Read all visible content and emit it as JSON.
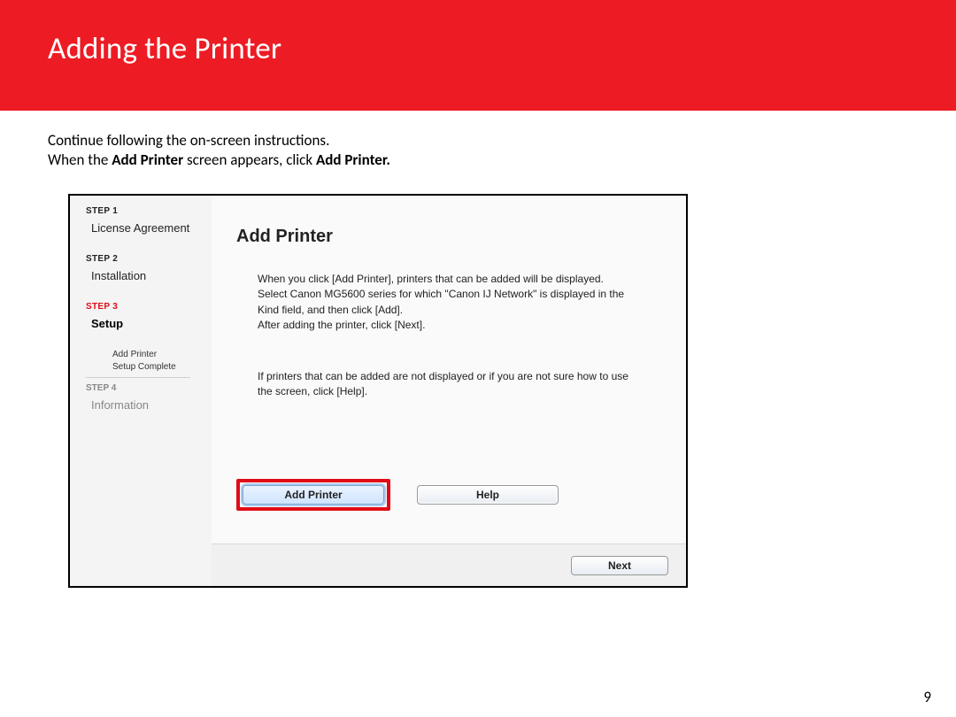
{
  "banner": {
    "title": "Adding  the Printer"
  },
  "body": {
    "line1": "Continue following the on-screen instructions.",
    "line2_pre": "When the ",
    "line2_b1": "Add Printer",
    "line2_mid": " screen appears, click ",
    "line2_b2": "Add Printer."
  },
  "sidebar": {
    "step1": "STEP 1",
    "step1_sub": "License Agreement",
    "step2": "STEP 2",
    "step2_sub": "Installation",
    "step3": "STEP 3",
    "step3_sub": "Setup",
    "sub_add": "Add Printer",
    "sub_complete": "Setup Complete",
    "step4": "STEP 4",
    "step4_sub": "Information"
  },
  "panel": {
    "title": "Add Printer",
    "para1": "When you click [Add Printer], printers that can be added will be displayed. Select Canon MG5600 series for which \"Canon IJ Network\" is displayed in the Kind field, and then click [Add].\nAfter adding the printer, click [Next].",
    "para2": "If printers that can be added are not displayed or if you are not sure how to use the screen, click [Help].",
    "btn_add": "Add Printer",
    "btn_help": "Help",
    "btn_next": "Next"
  },
  "page_number": "9"
}
